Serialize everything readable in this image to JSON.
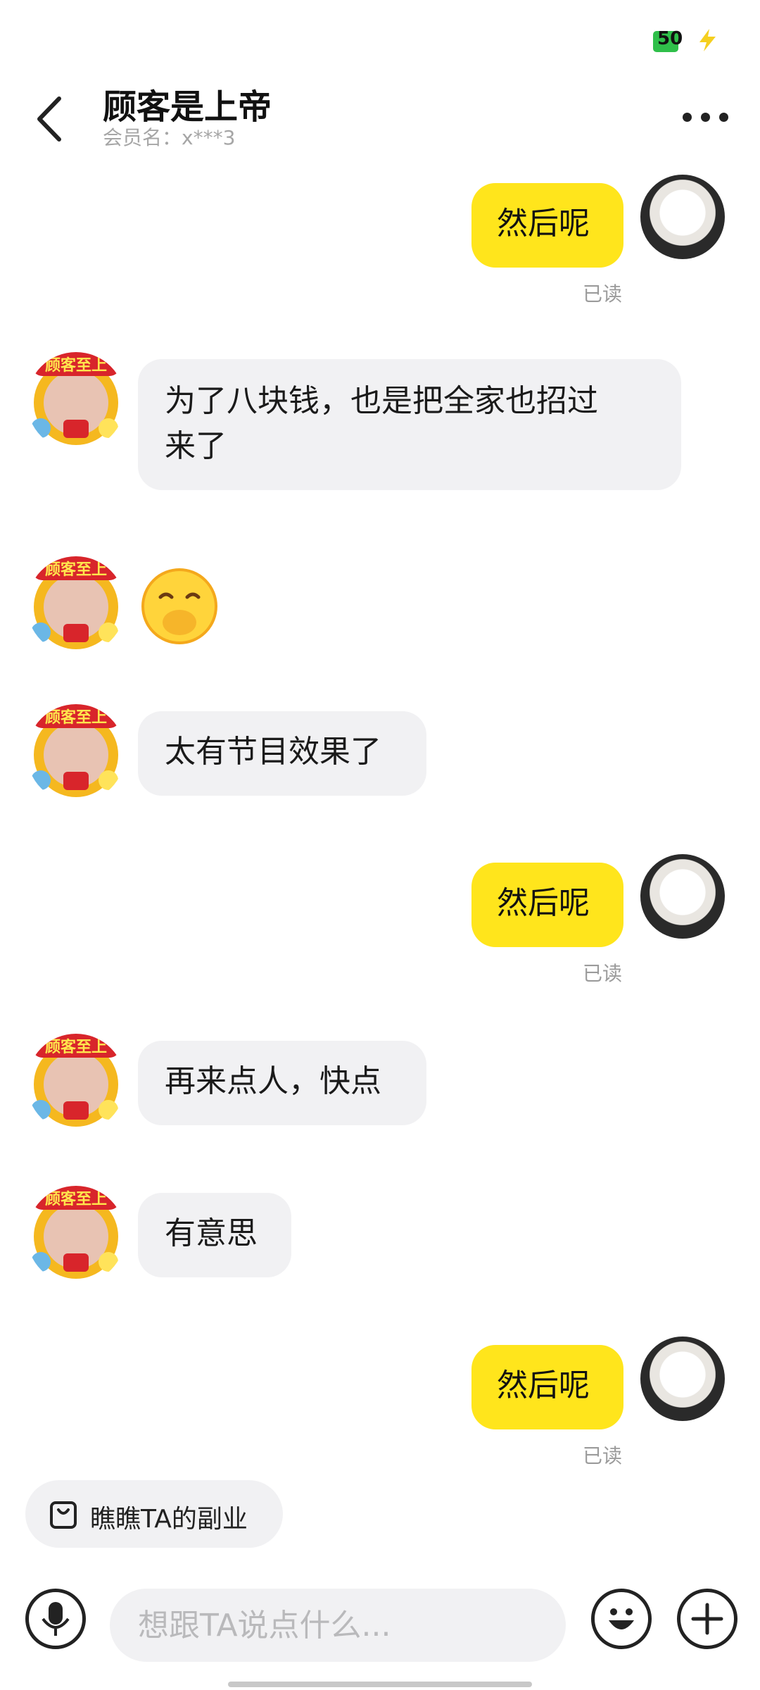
{
  "status": {
    "battery": "50"
  },
  "header": {
    "title": "顾客是上帝",
    "subtitle": "会员名：x***3"
  },
  "messages": [
    {
      "side": "me",
      "text": "然后呢",
      "read": "已读"
    },
    {
      "side": "them",
      "text": "为了八块钱，也是把全家也招过\n来了"
    },
    {
      "side": "them",
      "emoji": "face-hand-over-mouth"
    },
    {
      "side": "them",
      "text": "太有节目效果了"
    },
    {
      "side": "me",
      "text": "然后呢",
      "read": "已读"
    },
    {
      "side": "them",
      "text": "再来点人，快点"
    },
    {
      "side": "them",
      "text": "有意思"
    },
    {
      "side": "me",
      "text": "然后呢",
      "read": "已读"
    }
  ],
  "avatar_badge": "顾客至上",
  "chip": {
    "label": "瞧瞧TA的副业"
  },
  "composer": {
    "placeholder": "想跟TA说点什么..."
  },
  "colors": {
    "accent": "#ffe51c",
    "bubble_them": "#f1f1f3"
  }
}
